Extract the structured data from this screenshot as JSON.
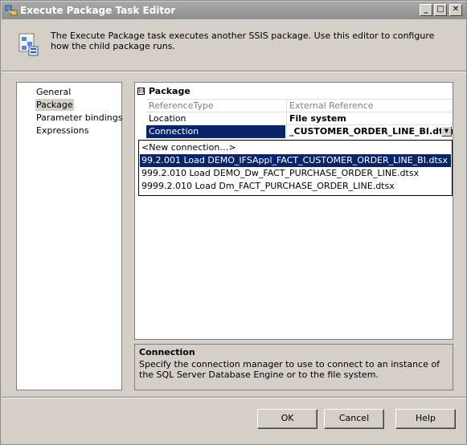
{
  "window": {
    "title": "Execute Package Task Editor",
    "controls": {
      "minimize": "_",
      "maximize": "□",
      "close": "✕"
    }
  },
  "header": {
    "description": "The Execute Package task executes another SSIS package. Use this editor to configure how the child package runs.",
    "icon": "package-task-icon"
  },
  "nav": {
    "items": [
      {
        "label": "General",
        "selected": false
      },
      {
        "label": "Package",
        "selected": true
      },
      {
        "label": "Parameter bindings",
        "selected": false
      },
      {
        "label": "Expressions",
        "selected": false
      }
    ]
  },
  "grid": {
    "category": {
      "toggle": "⊟",
      "label": "Package"
    },
    "rows": [
      {
        "name": "ReferenceType",
        "value": "External Reference"
      },
      {
        "name": "Location",
        "value": "File system"
      },
      {
        "name": "Connection",
        "value": "_CUSTOMER_ORDER_LINE_BI.dtsx"
      }
    ],
    "dropdown_button": "▼"
  },
  "dropdown": {
    "options": [
      "<New connection…>",
      "99.2.001 Load DEMO_IFSAppl_FACT_CUSTOMER_ORDER_LINE_BI.dtsx",
      "999.2.010 Load DEMO_Dw_FACT_PURCHASE_ORDER_LINE.dtsx",
      "9999.2.010 Load Dm_FACT_PURCHASE_ORDER_LINE.dtsx"
    ],
    "highlighted_index": 1
  },
  "description_panel": {
    "title": "Connection",
    "text": "Specify the connection manager to use to connect to an instance of the SQL Server Database Engine or to the file system."
  },
  "buttons": {
    "ok": "OK",
    "cancel": "Cancel",
    "help": "Help"
  },
  "colors": {
    "selection": "#0a246a",
    "dialog": "#d4d0c8"
  }
}
